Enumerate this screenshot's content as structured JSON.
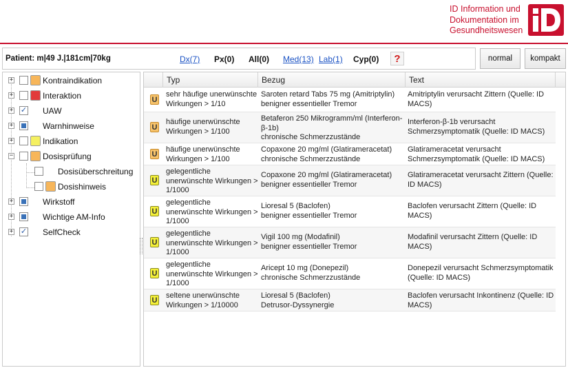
{
  "brand": {
    "lines": [
      "ID Information und",
      "Dokumentation im",
      "Gesundheitswesen"
    ],
    "logo_text": "iD",
    "logo_color": "#c8102e"
  },
  "patient": {
    "label": "Patient: m|49 J.|181cm|70kg"
  },
  "nav": [
    {
      "label": "Dx(7)",
      "link": true
    },
    {
      "label": "Px(0)",
      "link": false
    },
    {
      "label": "All(0)",
      "link": false
    },
    {
      "label": "Med(13)",
      "link": true
    },
    {
      "label": "Lab(1)",
      "link": true
    },
    {
      "label": "Cyp(0)",
      "link": false
    }
  ],
  "help": {
    "label": "?"
  },
  "view_buttons": {
    "normal": "normal",
    "kompakt": "kompakt"
  },
  "tree": [
    {
      "label": "Kontraindikation",
      "checked": false,
      "color": "#f7b65a",
      "level": 0
    },
    {
      "label": "Interaktion",
      "checked": false,
      "color": "#e23a3a",
      "level": 0
    },
    {
      "label": "UAW",
      "checked": true,
      "color": null,
      "level": 0
    },
    {
      "label": "Warnhinweise",
      "checked": "partial",
      "color": null,
      "level": 0
    },
    {
      "label": "Indikation",
      "checked": false,
      "color": "#f5f060",
      "level": 0
    },
    {
      "label": "Dosisprüfung",
      "checked": false,
      "color": "#f7b65a",
      "level": 0,
      "expanded": true
    },
    {
      "label": "Dosisüberschreitung",
      "checked": false,
      "color": null,
      "level": 1
    },
    {
      "label": "Dosishinweis",
      "checked": false,
      "color": "#f7b65a",
      "level": 1
    },
    {
      "label": "Wirkstoff",
      "checked": "partial",
      "color": null,
      "level": 0
    },
    {
      "label": "Wichtige AM-Info",
      "checked": "partial",
      "color": null,
      "level": 0
    },
    {
      "label": "SelfCheck",
      "checked": true,
      "color": null,
      "level": 0
    }
  ],
  "grid": {
    "columns": [
      "Typ",
      "Bezug",
      "Text"
    ],
    "rows": [
      {
        "badge": "U",
        "badge_color": "orange",
        "typ": [
          "sehr häufige unerwünschte",
          "Wirkungen > 1/10"
        ],
        "bezug": [
          "Saroten retard Tabs 75 mg (Amitriptylin)",
          "benigner essentieller Tremor"
        ],
        "text": [
          "Amitriptylin verursacht Zittern (Quelle: ID",
          "MACS)"
        ]
      },
      {
        "badge": "U",
        "badge_color": "orange",
        "typ": [
          "häufige unerwünschte",
          "Wirkungen > 1/100"
        ],
        "bezug": [
          "Betaferon 250 Mikrogramm/ml (Interferon-",
          "β-1b)",
          "chronische Schmerzzustände"
        ],
        "text": [
          "Interferon-β-1b verursacht",
          "Schmerzsymptomatik (Quelle: ID MACS)"
        ]
      },
      {
        "badge": "U",
        "badge_color": "orange",
        "typ": [
          "häufige unerwünschte",
          "Wirkungen > 1/100"
        ],
        "bezug": [
          "Copaxone 20 mg/ml (Glatirameracetat)",
          "chronische Schmerzzustände"
        ],
        "text": [
          "Glatirameracetat verursacht",
          "Schmerzsymptomatik (Quelle: ID MACS)"
        ]
      },
      {
        "badge": "U",
        "badge_color": "yellow",
        "typ": [
          "gelegentliche",
          "unerwünschte Wirkungen >",
          "1/1000"
        ],
        "bezug": [
          "Copaxone 20 mg/ml (Glatirameracetat)",
          "benigner essentieller Tremor"
        ],
        "text": [
          "Glatirameracetat verursacht Zittern (Quelle:",
          "ID MACS)"
        ]
      },
      {
        "badge": "U",
        "badge_color": "yellow",
        "typ": [
          "gelegentliche",
          "unerwünschte Wirkungen >",
          "1/1000"
        ],
        "bezug": [
          "Lioresal 5 (Baclofen)",
          "benigner essentieller Tremor"
        ],
        "text": [
          "Baclofen verursacht Zittern (Quelle: ID",
          "MACS)"
        ]
      },
      {
        "badge": "U",
        "badge_color": "yellow",
        "typ": [
          "gelegentliche",
          "unerwünschte Wirkungen >",
          "1/1000"
        ],
        "bezug": [
          "Vigil 100 mg (Modafinil)",
          "benigner essentieller Tremor"
        ],
        "text": [
          "Modafinil verursacht Zittern (Quelle: ID",
          "MACS)"
        ]
      },
      {
        "badge": "U",
        "badge_color": "yellow",
        "typ": [
          "gelegentliche",
          "unerwünschte Wirkungen >",
          "1/1000"
        ],
        "bezug": [
          "Aricept 10 mg (Donepezil)",
          "chronische Schmerzzustände"
        ],
        "text": [
          "Donepezil verursacht Schmerzsymptomatik",
          "(Quelle: ID MACS)"
        ]
      },
      {
        "badge": "U",
        "badge_color": "yellow",
        "typ": [
          "seltene unerwünschte",
          "Wirkungen > 1/10000"
        ],
        "bezug": [
          "Lioresal 5 (Baclofen)",
          "Detrusor-Dyssynergie"
        ],
        "text": [
          "Baclofen verursacht Inkontinenz (Quelle: ID",
          "MACS)"
        ]
      }
    ]
  }
}
